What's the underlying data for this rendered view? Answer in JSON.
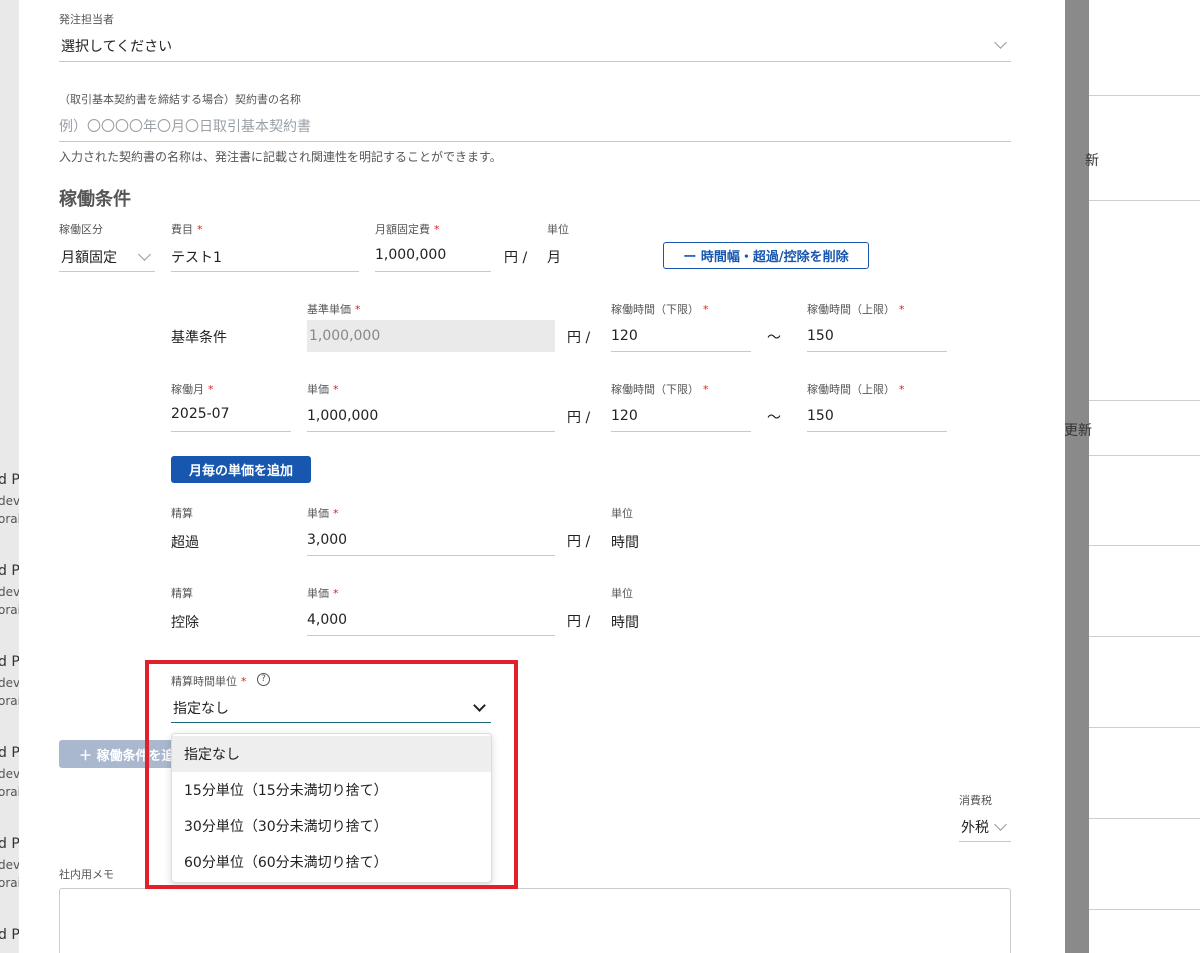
{
  "background": {
    "row_texts": [
      "d P",
      "dev",
      "orai"
    ],
    "right_labels": [
      "新",
      "更新"
    ]
  },
  "form": {
    "order_person": {
      "label": "発注担当者",
      "value": "選択してください"
    },
    "contract_name": {
      "label": "（取引基本契約書を締結する場合）契約書の名称",
      "placeholder": "例）〇〇〇〇年〇月〇日取引基本契約書",
      "note": "入力された契約書の名称は、発注書に記載され関連性を明記することができます。"
    },
    "section_title": "稼働条件",
    "work_type": {
      "label": "稼働区分",
      "value": "月額固定"
    },
    "expense": {
      "label": "費目",
      "value": "テスト1"
    },
    "monthly_fee": {
      "label": "月額固定費",
      "value": "1,000,000",
      "suffix": "円 /"
    },
    "unit": {
      "label": "単位",
      "value": "月"
    },
    "remove_button": "ー 時間幅・超過/控除を削除",
    "base": {
      "row_label": "基準条件",
      "unit_price_label": "基準単価",
      "unit_price": "1,000,000",
      "suffix": "円 /",
      "min_label": "稼働時間（下限）",
      "min": "120",
      "tilde": "〜",
      "max_label": "稼働時間（上限）",
      "max": "150"
    },
    "monthly": {
      "month_label": "稼働月",
      "month": "2025-07",
      "unit_price_label": "単価",
      "unit_price": "1,000,000",
      "suffix": "円 /",
      "min_label": "稼働時間（下限）",
      "min": "120",
      "tilde": "〜",
      "max_label": "稼働時間（上限）",
      "max": "150"
    },
    "add_monthly_button": "月毎の単価を追加",
    "overtime": {
      "settle_label": "精算",
      "settle_value": "超過",
      "unit_price_label": "単価",
      "unit_price": "3,000",
      "suffix": "円 /",
      "unit_label": "単位",
      "unit": "時間"
    },
    "deduction": {
      "settle_label": "精算",
      "settle_value": "控除",
      "unit_price_label": "単価",
      "unit_price": "4,000",
      "suffix": "円 /",
      "unit_label": "単位",
      "unit": "時間"
    },
    "settle_time_unit": {
      "label": "精算時間単位",
      "help": "?",
      "value": "指定なし",
      "options": [
        "指定なし",
        "15分単位（15分未満切り捨て）",
        "30分単位（30分未満切り捨て）",
        "60分単位（60分未満切り捨て）"
      ]
    },
    "add_condition_button": "＋ 稼働条件を追加",
    "tax": {
      "label": "消費税",
      "value": "外税"
    },
    "memo": {
      "label": "社内用メモ"
    },
    "required_mark": "*"
  },
  "colors": {
    "primary": "#1857b0",
    "required": "#e02020",
    "highlight": "#e0202a"
  }
}
